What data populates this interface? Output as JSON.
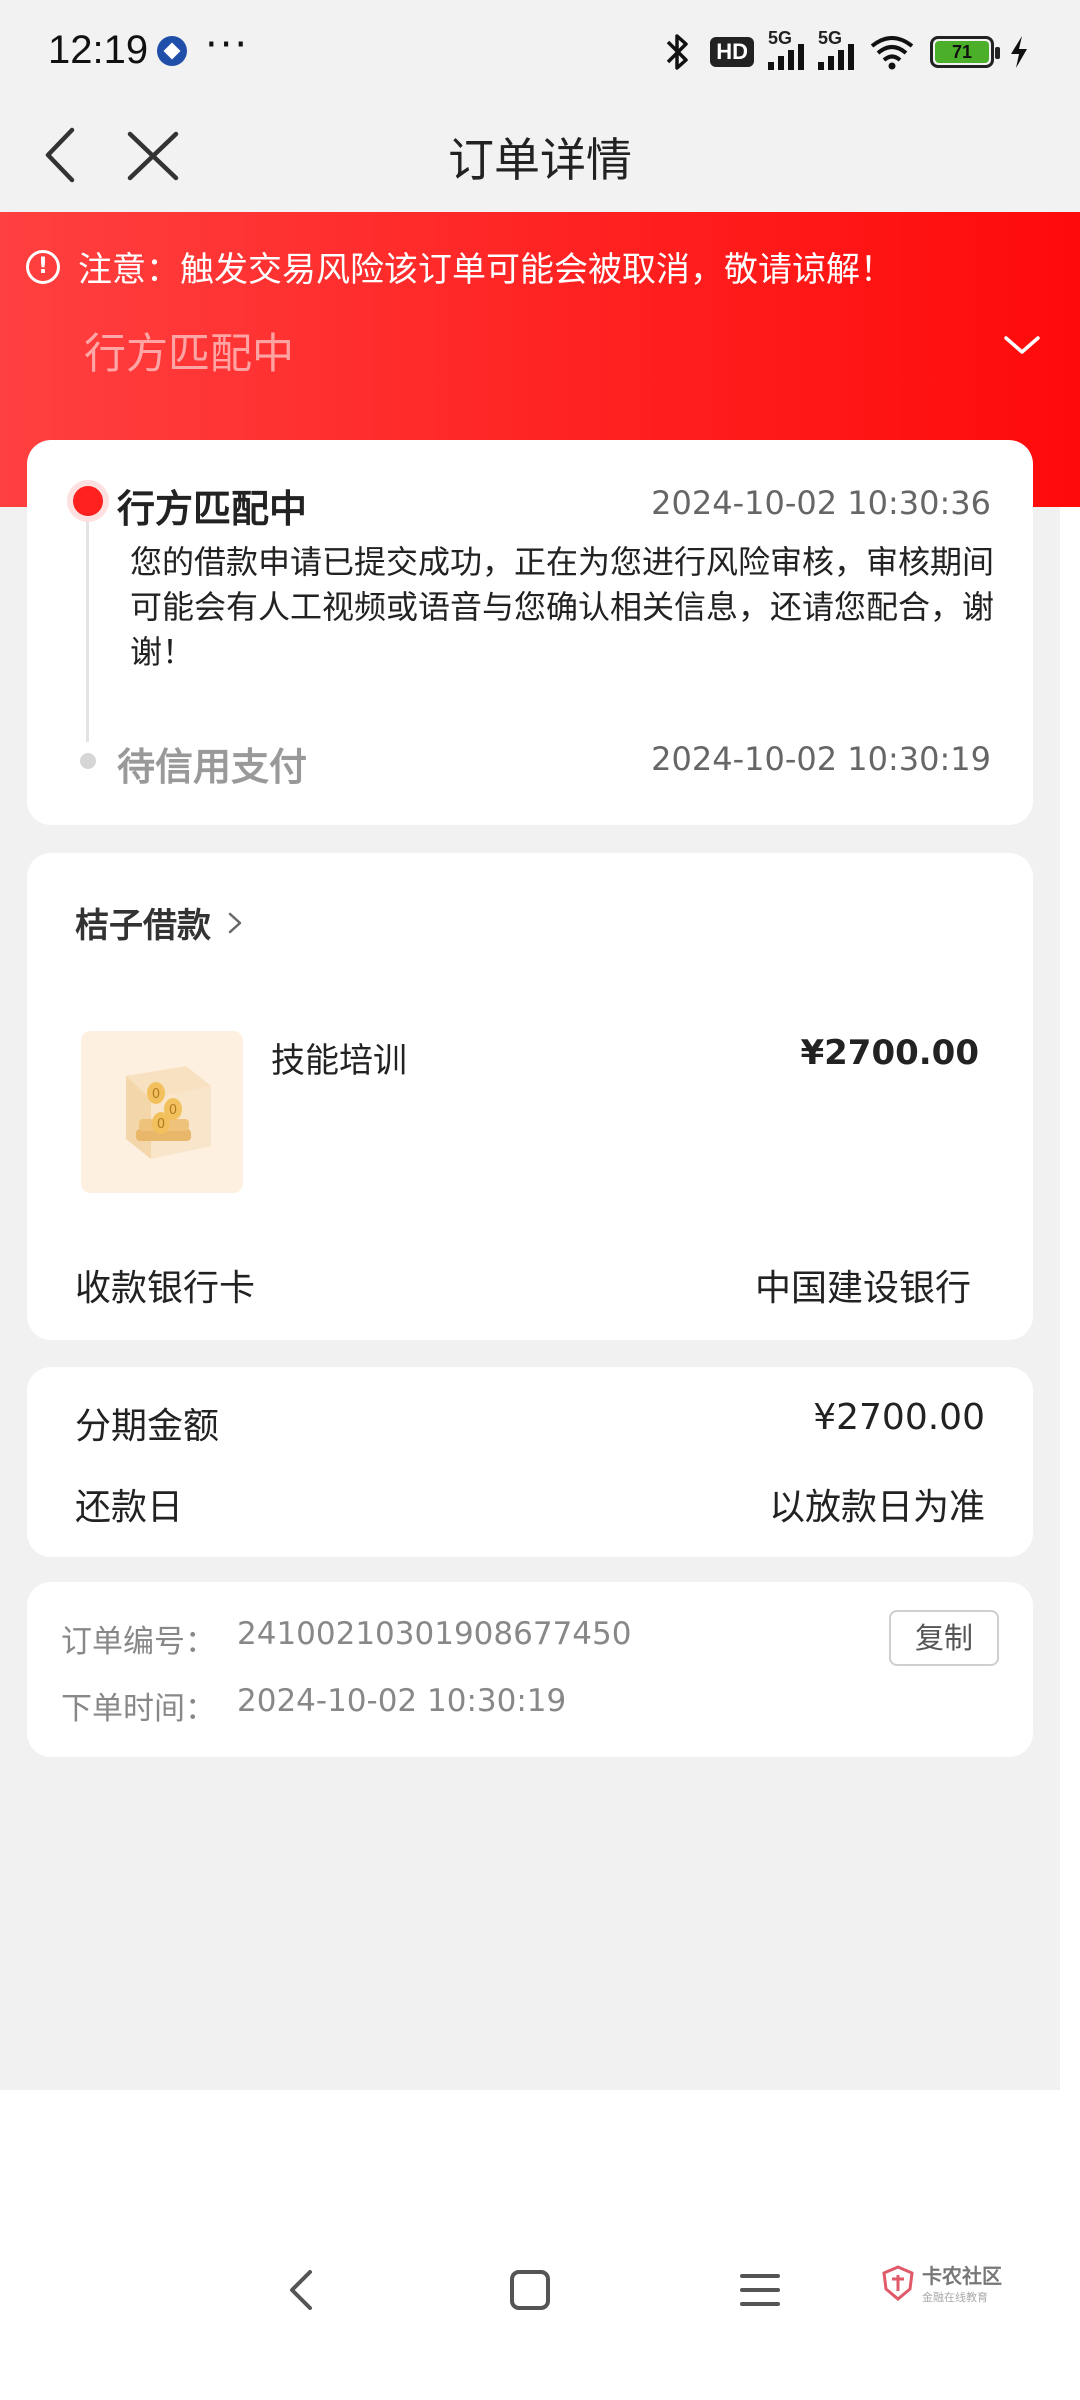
{
  "status_bar": {
    "time": "12:19",
    "dots": "···",
    "hd_badge": "HD",
    "signal1_label": "5G",
    "signal2_label": "5G",
    "battery_level": "71",
    "icons": [
      "bluetooth-icon",
      "signal-icon",
      "wifi-icon",
      "battery-icon",
      "charging-icon"
    ]
  },
  "header": {
    "title": "订单详情",
    "back_icon": "chevron-left-icon",
    "close_icon": "close-icon"
  },
  "banner": {
    "warning_icon": "!",
    "warning_text": "注意：触发交易风险该订单可能会被取消，敬请谅解！",
    "status": "行方匹配中"
  },
  "timeline": [
    {
      "title": "行方匹配中",
      "time": "2024-10-02 10:30:36",
      "description": "您的借款申请已提交成功，正在为您进行风险审核，审核期间可能会有人工视频或语音与您确认相关信息，还请您配合，谢谢！"
    },
    {
      "title": "待信用支付",
      "time": "2024-10-02 10:30:19"
    }
  ],
  "merchant": {
    "name": "桔子借款",
    "product_name": "技能培训",
    "price": "¥2700.00",
    "bank_label": "收款银行卡",
    "bank_value": "中国建设银行"
  },
  "installment": {
    "amount_label": "分期金额",
    "amount_value": "¥2700.00",
    "repay_label": "还款日",
    "repay_value": "以放款日为准"
  },
  "order": {
    "number_label": "订单编号：",
    "number_value": "24100210301908677450",
    "time_label": "下单时间：",
    "time_value": "2024-10-02 10:30:19",
    "copy_label": "复制"
  },
  "watermark": {
    "main": "卡农社区",
    "sub": "金融在线教育"
  },
  "colors": {
    "accent_red": "#ff2020",
    "page_bg": "#f1f1f1"
  }
}
